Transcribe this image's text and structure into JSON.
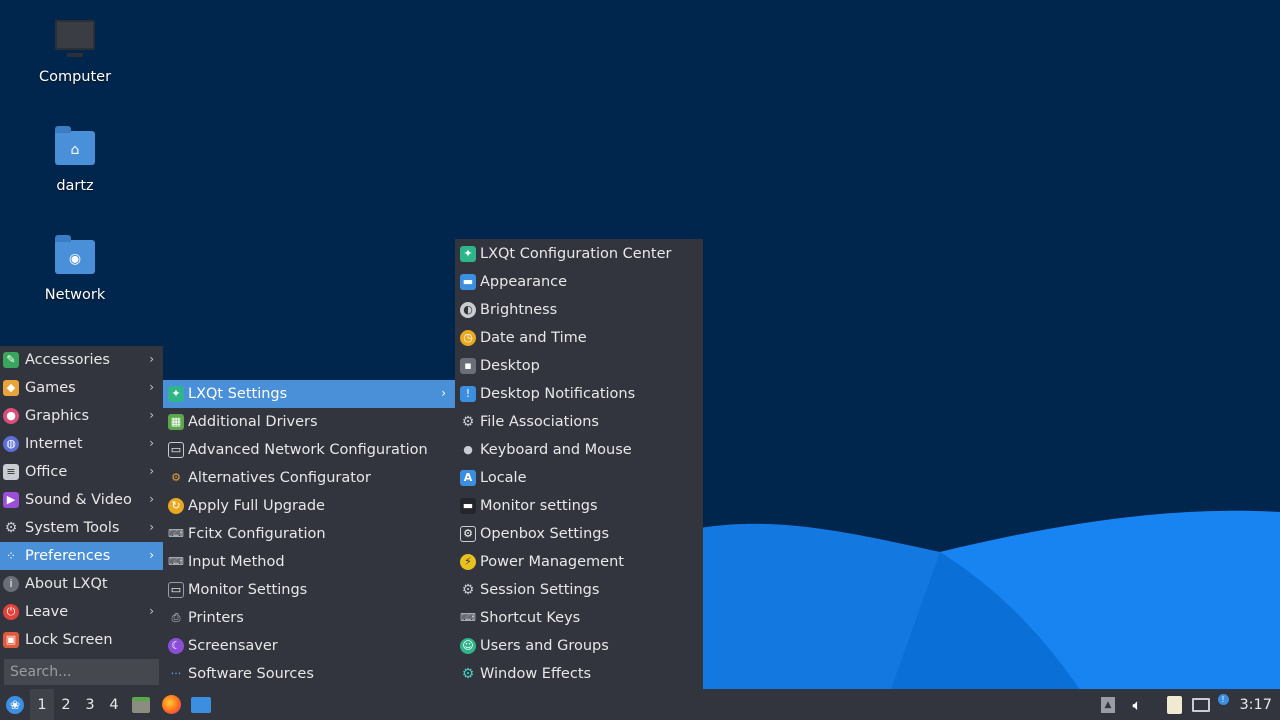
{
  "desktop": {
    "icons": [
      {
        "label": "Computer",
        "icon": "computer-icon"
      },
      {
        "label": "dartz",
        "icon": "home-folder-icon"
      },
      {
        "label": "Network",
        "icon": "network-folder-icon"
      }
    ]
  },
  "main_menu": {
    "items": [
      {
        "label": "Accessories",
        "icon": "accessories-icon",
        "submenu": true
      },
      {
        "label": "Games",
        "icon": "games-icon",
        "submenu": true
      },
      {
        "label": "Graphics",
        "icon": "graphics-icon",
        "submenu": true
      },
      {
        "label": "Internet",
        "icon": "internet-icon",
        "submenu": true
      },
      {
        "label": "Office",
        "icon": "office-icon",
        "submenu": true
      },
      {
        "label": "Sound & Video",
        "icon": "sound-video-icon",
        "submenu": true
      },
      {
        "label": "System Tools",
        "icon": "system-tools-icon",
        "submenu": true
      },
      {
        "label": "Preferences",
        "icon": "preferences-icon",
        "submenu": true,
        "active": true
      },
      {
        "label": "About LXQt",
        "icon": "info-icon",
        "submenu": false
      },
      {
        "label": "Leave",
        "icon": "power-icon",
        "submenu": true
      },
      {
        "label": "Lock Screen",
        "icon": "lock-icon",
        "submenu": false
      }
    ],
    "search_placeholder": "Search..."
  },
  "preferences_menu": {
    "items": [
      {
        "label": "LXQt Settings",
        "icon": "lxqt-settings-icon",
        "submenu": true,
        "active": true
      },
      {
        "label": "Additional Drivers",
        "icon": "chip-icon"
      },
      {
        "label": "Advanced Network Configuration",
        "icon": "network-config-icon"
      },
      {
        "label": "Alternatives Configurator",
        "icon": "alternatives-icon"
      },
      {
        "label": "Apply Full Upgrade",
        "icon": "upgrade-icon"
      },
      {
        "label": "Fcitx Configuration",
        "icon": "keyboard-icon"
      },
      {
        "label": "Input Method",
        "icon": "input-method-icon"
      },
      {
        "label": "Monitor Settings",
        "icon": "monitor-icon"
      },
      {
        "label": "Printers",
        "icon": "printer-icon"
      },
      {
        "label": "Screensaver",
        "icon": "screensaver-icon"
      },
      {
        "label": "Software Sources",
        "icon": "software-sources-icon"
      }
    ]
  },
  "lxqt_settings_menu": {
    "items": [
      {
        "label": "LXQt Configuration Center",
        "icon": "config-center-icon"
      },
      {
        "label": "Appearance",
        "icon": "appearance-icon"
      },
      {
        "label": "Brightness",
        "icon": "brightness-icon"
      },
      {
        "label": "Date and Time",
        "icon": "clock-icon"
      },
      {
        "label": "Desktop",
        "icon": "desktop-icon"
      },
      {
        "label": "Desktop Notifications",
        "icon": "notification-icon"
      },
      {
        "label": "File Associations",
        "icon": "file-associations-icon"
      },
      {
        "label": "Keyboard and Mouse",
        "icon": "mouse-icon"
      },
      {
        "label": "Locale",
        "icon": "locale-icon"
      },
      {
        "label": "Monitor settings",
        "icon": "monitor-settings-icon"
      },
      {
        "label": "Openbox Settings",
        "icon": "openbox-icon"
      },
      {
        "label": "Power Management",
        "icon": "power-management-icon"
      },
      {
        "label": "Session Settings",
        "icon": "session-icon"
      },
      {
        "label": "Shortcut Keys",
        "icon": "shortcut-keys-icon"
      },
      {
        "label": "Users and Groups",
        "icon": "users-icon"
      },
      {
        "label": "Window Effects",
        "icon": "window-effects-icon"
      }
    ]
  },
  "taskbar": {
    "workspaces": [
      "1",
      "2",
      "3",
      "4"
    ],
    "active_workspace": "1",
    "quicklaunch": [
      "file-manager-icon",
      "firefox-icon",
      "desktop-icon"
    ],
    "tray": [
      "removable-media-icon",
      "volume-icon",
      "clipboard-icon",
      "network-icon",
      "update-notifier-icon"
    ],
    "clock": "3:17"
  },
  "colors": {
    "desktop_bg": "#00264d",
    "wave": "#1a8cff",
    "panel": "#32353d",
    "highlight": "#4a90d9"
  }
}
